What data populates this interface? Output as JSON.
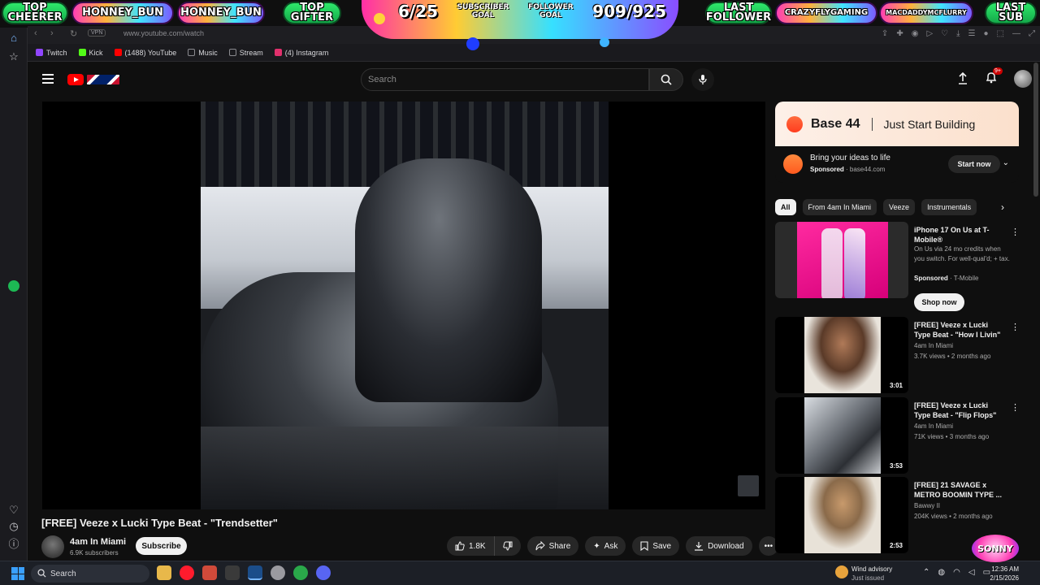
{
  "overlay": {
    "top_cheerer_label": "TOP\nCHEERER",
    "cheerer_name": "HONNEY_BUN",
    "gifter_name": "HONNEY_BUN",
    "top_gifter_label": "TOP\nGIFTER",
    "subscriber_count": "6/25",
    "subscriber_goal_label": "SUBSCRIBER\nGOAL",
    "follower_goal_label": "FOLLOWER\nGOAL",
    "follower_count": "909/925",
    "last_follower_label": "LAST\nFOLLOWER",
    "last_follower_name": "CRAZYFLYGAMING",
    "last_sub_name": "MACDADDYMCFLURRY",
    "last_sub_label": "LAST\nSUB",
    "corner_logo": "SONNY"
  },
  "browser": {
    "url": "www.youtube.com/watch",
    "vpn_label": "VPN",
    "bookmarks": [
      {
        "label": "Twitch",
        "color": "#9146ff"
      },
      {
        "label": "Kick",
        "color": "#53fc18"
      },
      {
        "label": "(1488) YouTube",
        "color": "#ff0000"
      },
      {
        "label": "Music",
        "color": "#8a8a8f"
      },
      {
        "label": "Stream",
        "color": "#8a8a8f"
      },
      {
        "label": "(4) Instagram",
        "color": "#e1306c"
      }
    ]
  },
  "masthead": {
    "search_placeholder": "Search",
    "notification_count": "9+"
  },
  "video": {
    "title": "[FREE] Veeze x Lucki Type Beat - \"Trendsetter\"",
    "channel_name": "4am In Miami",
    "channel_subs": "6.9K subscribers",
    "subscribe_label": "Subscribe",
    "like_count": "1.8K",
    "share_label": "Share",
    "ask_label": "Ask",
    "save_label": "Save",
    "download_label": "Download"
  },
  "ad": {
    "brand": "Base 44",
    "tagline": "Just Start Building",
    "headline": "Bring your ideas to life",
    "sponsored": "Sponsored",
    "domain": "base44.com",
    "cta": "Start now"
  },
  "chips": [
    "All",
    "From 4am In Miami",
    "Veeze",
    "Instrumentals"
  ],
  "recommendations": [
    {
      "title": "iPhone 17 On Us at T-Mobile®",
      "line1": "On Us via 24 mo credits when you switch. For well-qual'd; + tax.",
      "sponsored": "Sponsored",
      "advertiser": "T-Mobile",
      "cta": "Shop now"
    },
    {
      "title": "[FREE] Veeze x Lucki Type Beat - \"How I Livin\"",
      "channel": "4am In Miami",
      "stats": "3.7K views • 2 months ago",
      "duration": "3:01"
    },
    {
      "title": "[FREE] Veeze x Lucki Type Beat - \"Flip Flops\"",
      "channel": "4am In Miami",
      "stats": "71K views • 3 months ago",
      "duration": "3:53"
    },
    {
      "title": "[FREE] 21 SAVAGE x METRO BOOMIN TYPE ...",
      "channel": "Bawwy II",
      "stats": "204K views • 2 months ago",
      "duration": "2:53"
    }
  ],
  "taskbar": {
    "search_label": "Search",
    "weather_title": "Wind advisory",
    "weather_sub": "Just issued",
    "time": "12:36 AM",
    "date": "2/15/2026"
  }
}
